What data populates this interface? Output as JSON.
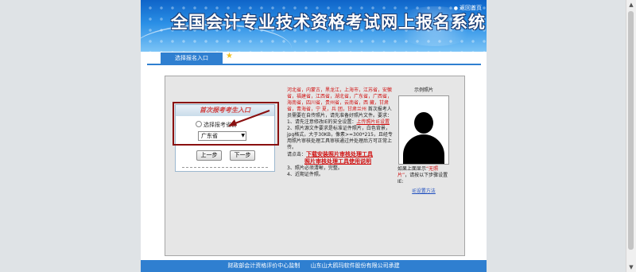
{
  "header": {
    "title": "全国会计专业技术资格考试网上报名系统",
    "home_link": "返回首页"
  },
  "tab": {
    "label": "选择报名入口"
  },
  "login": {
    "box_title": "首次报考考生入口",
    "radio_label": "选择报考省份",
    "province_selected": "广东省",
    "prev_button": "上一步",
    "next_button": "下一步"
  },
  "info": {
    "provinces_text": "河北省，内蒙古，黑龙江，上海市，江苏省，安徽省，福建省，江西省，湖北省，广东省，广西省，海南省，四川省，贵州省，云南省，西 藏，甘肃省，青海省，宁 夏，兵 团，甘肃兰州",
    "provinces_tail": " 首次报考人员需要在自传照片，请先准备好照片文件。要求：",
    "step1_text": "1、请先注意修改IE的安全设置：",
    "step1_link": "上传照片IE设置",
    "step2_text": "2、照片源文件要求是标准证件照片，白色背景，jpg格式，大于30KB，像素>=300*215，且经专用照片审核处理工具审核通过并处理后方可正常上传。",
    "download_prefix": "请点击：",
    "download_link": "下载安装照片审核处理工具",
    "manual_link": "照片审核处理工具使用说明",
    "step3_text": "3、照片必须清晰，完整。",
    "step4_text": "4、近期证件照。"
  },
  "photo": {
    "title": "示例照片",
    "note_prefix": "如果上面显示",
    "note_red": "“无照片”",
    "note_suffix": "，请按以下步骤设置IE:",
    "ie_link": "IE设置方法"
  },
  "footer": {
    "left": "财政部会计资格评价中心监制",
    "right": "山东山大鸥玛软件股份有限公司承建"
  }
}
